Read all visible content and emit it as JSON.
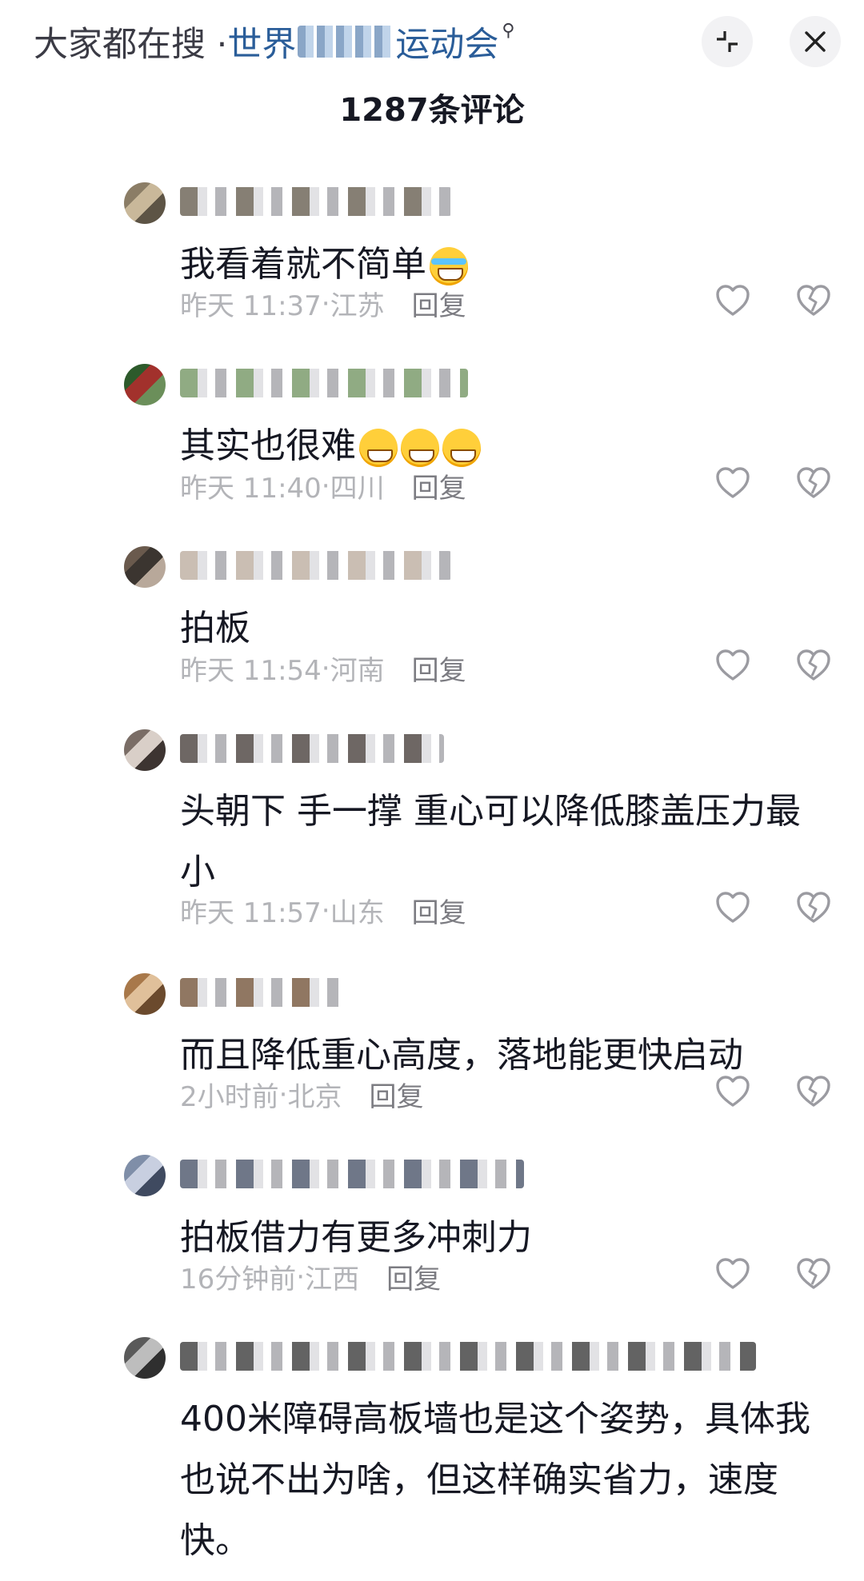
{
  "search_hint": {
    "prefix": "大家都在搜 · ",
    "keyword_visible": "世界",
    "keyword_tail": "运动会",
    "search_icon": "search-icon"
  },
  "top_buttons": {
    "minimize_icon": "collapse-icon",
    "close_icon": "close-icon",
    "minimize_glyph": "⤡",
    "close_glyph": "✕"
  },
  "header": {
    "count_title": "1287条评论"
  },
  "colors": {
    "text_primary": "#161823",
    "text_meta": "#b3b4b8",
    "keyword_blue": "#2a5d99",
    "icon_gray": "#9b9ba1"
  },
  "comments": [
    {
      "text": "我看着就不简单",
      "emoji": "tears",
      "emoji_count": 1,
      "time": "昨天 11:37",
      "location": "江苏",
      "reply": "回复"
    },
    {
      "text": "其实也很难",
      "emoji": "grin",
      "emoji_count": 3,
      "time": "昨天 11:40",
      "location": "四川",
      "reply": "回复"
    },
    {
      "text": "拍板",
      "emoji": "",
      "emoji_count": 0,
      "time": "昨天 11:54",
      "location": "河南",
      "reply": "回复"
    },
    {
      "text": "头朝下 手一撑 重心可以降低膝盖压力最小",
      "emoji": "",
      "emoji_count": 0,
      "time": "昨天 11:57",
      "location": "山东",
      "reply": "回复"
    },
    {
      "text": "而且降低重心高度，落地能更快启动",
      "emoji": "",
      "emoji_count": 0,
      "time": "2小时前",
      "location": "北京",
      "reply": "回复"
    },
    {
      "text": "拍板借力有更多冲刺力",
      "emoji": "",
      "emoji_count": 0,
      "time": "16分钟前",
      "location": "江西",
      "reply": "回复"
    },
    {
      "text": "400米障碍高板墙也是这个姿势，具体我也说不出为啥，但这样确实省力，速度快。",
      "emoji": "",
      "emoji_count": 0,
      "time": "",
      "location": "",
      "reply": ""
    }
  ]
}
